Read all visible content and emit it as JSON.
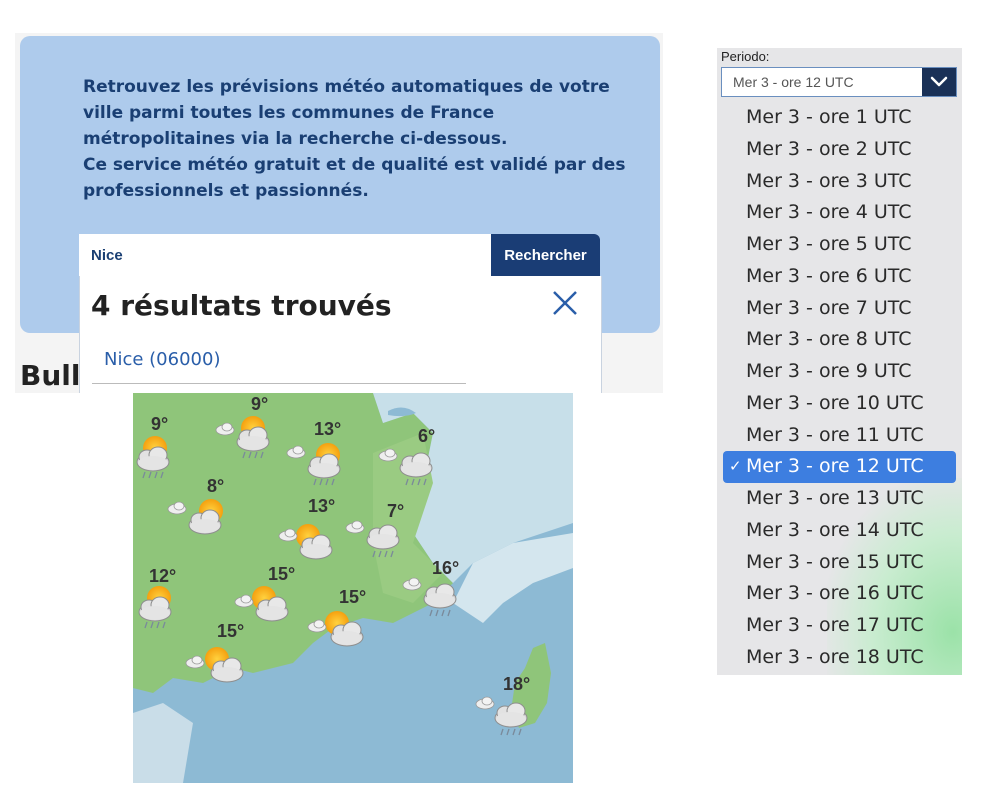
{
  "search": {
    "intro_lines": [
      "Retrouvez les prévisions météo automatiques de votre",
      "ville parmi toutes les communes de France",
      "métropolitaines via la recherche ci-dessous.",
      "Ce service météo gratuit et de qualité est validé par des",
      "professionnels et passionnés."
    ],
    "input_value": "Nice",
    "button_label": "Rechercher",
    "results_title": "4 résultats trouvés",
    "results": [
      "Nice (06000)"
    ],
    "partial_heading": "Bulle"
  },
  "map": {
    "land_color": "#8fc57a",
    "sea_color": "#8dbad4",
    "forecasts": [
      {
        "temp": "9°",
        "icon": "sun-cloud-rain-icon"
      },
      {
        "temp": "9°",
        "icon": "sun-cloud-rain-icon"
      },
      {
        "temp": "13°",
        "icon": "sun-cloud-rain-icon"
      },
      {
        "temp": "6°",
        "icon": "cloud-rain-icon"
      },
      {
        "temp": "8°",
        "icon": "sun-cloud-icon"
      },
      {
        "temp": "13°",
        "icon": "sun-cloud-icon"
      },
      {
        "temp": "7°",
        "icon": "cloud-rain-icon"
      },
      {
        "temp": "12°",
        "icon": "sun-cloud-rain-icon"
      },
      {
        "temp": "15°",
        "icon": "sun-cloud-icon"
      },
      {
        "temp": "15°",
        "icon": "sun-cloud-icon"
      },
      {
        "temp": "16°",
        "icon": "cloud-rain-icon"
      },
      {
        "temp": "15°",
        "icon": "sun-cloud-icon"
      },
      {
        "temp": "18°",
        "icon": "cloud-rain-icon"
      }
    ]
  },
  "period": {
    "label": "Periodo:",
    "selected": "Mer 3 - ore 12 UTC",
    "selected_index": 11,
    "check_mark": "✓",
    "options": [
      "Mer 3 - ore 1 UTC",
      "Mer 3 - ore 2 UTC",
      "Mer 3 - ore 3 UTC",
      "Mer 3 - ore 4 UTC",
      "Mer 3 - ore 5 UTC",
      "Mer 3 - ore 6 UTC",
      "Mer 3 - ore 7 UTC",
      "Mer 3 - ore 8 UTC",
      "Mer 3 - ore 9 UTC",
      "Mer 3 - ore 10 UTC",
      "Mer 3 - ore 11 UTC",
      "Mer 3 - ore 12 UTC",
      "Mer 3 - ore 13 UTC",
      "Mer 3 - ore 14 UTC",
      "Mer 3 - ore 15 UTC",
      "Mer 3 - ore 16 UTC",
      "Mer 3 - ore 17 UTC",
      "Mer 3 - ore 18 UTC"
    ],
    "accent_color": "#3d7ee0"
  }
}
